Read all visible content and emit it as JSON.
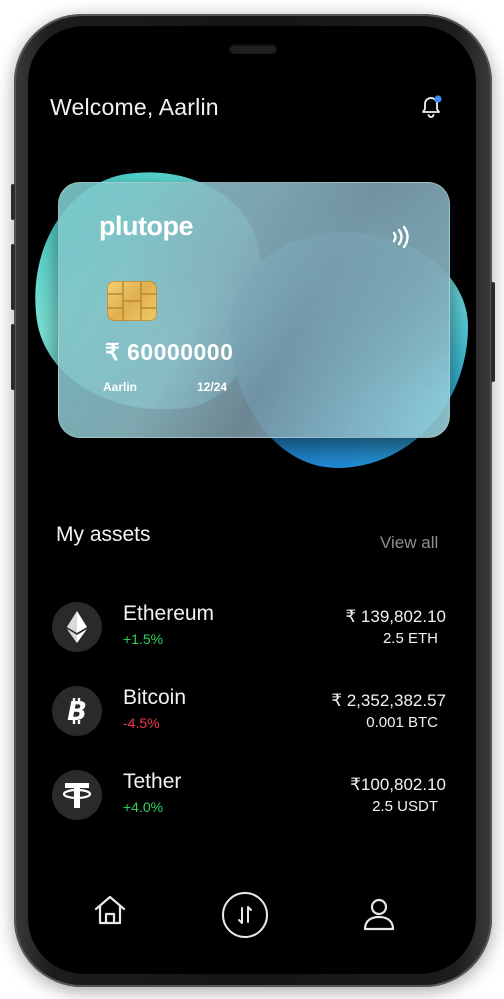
{
  "header": {
    "welcome": "Welcome, Aarlin",
    "notification_icon": "bell-icon",
    "notification_dot_color": "#3a8cff"
  },
  "card": {
    "brand": "plutope",
    "balance": "₹ 60000000",
    "holder": "Aarlin",
    "expiry": "12/24",
    "chip_icon": "card-chip-icon",
    "contactless_icon": "contactless-icon"
  },
  "assets": {
    "title": "My assets",
    "view_all": "View all",
    "items": [
      {
        "name": "Ethereum",
        "change": "+1.5%",
        "value": "₹ 139,802.10",
        "quantity": "2.5 ETH",
        "icon": "ethereum-icon",
        "trend": "up"
      },
      {
        "name": "Bitcoin",
        "change": "-4.5%",
        "value": "₹ 2,352,382.57",
        "quantity": "0.001 BTC",
        "icon": "bitcoin-icon",
        "trend": "down"
      },
      {
        "name": "Tether",
        "change": "+4.0%",
        "value": "₹100,802.10",
        "quantity": "2.5 USDT",
        "icon": "tether-icon",
        "trend": "up"
      }
    ]
  },
  "nav": {
    "items": [
      {
        "icon": "home-icon"
      },
      {
        "icon": "swap-icon"
      },
      {
        "icon": "profile-icon"
      }
    ]
  },
  "colors": {
    "positive": "#2fd15a",
    "negative": "#f0384b",
    "accent_teal": "#3fd0c9",
    "accent_blue": "#1c7fd8"
  }
}
